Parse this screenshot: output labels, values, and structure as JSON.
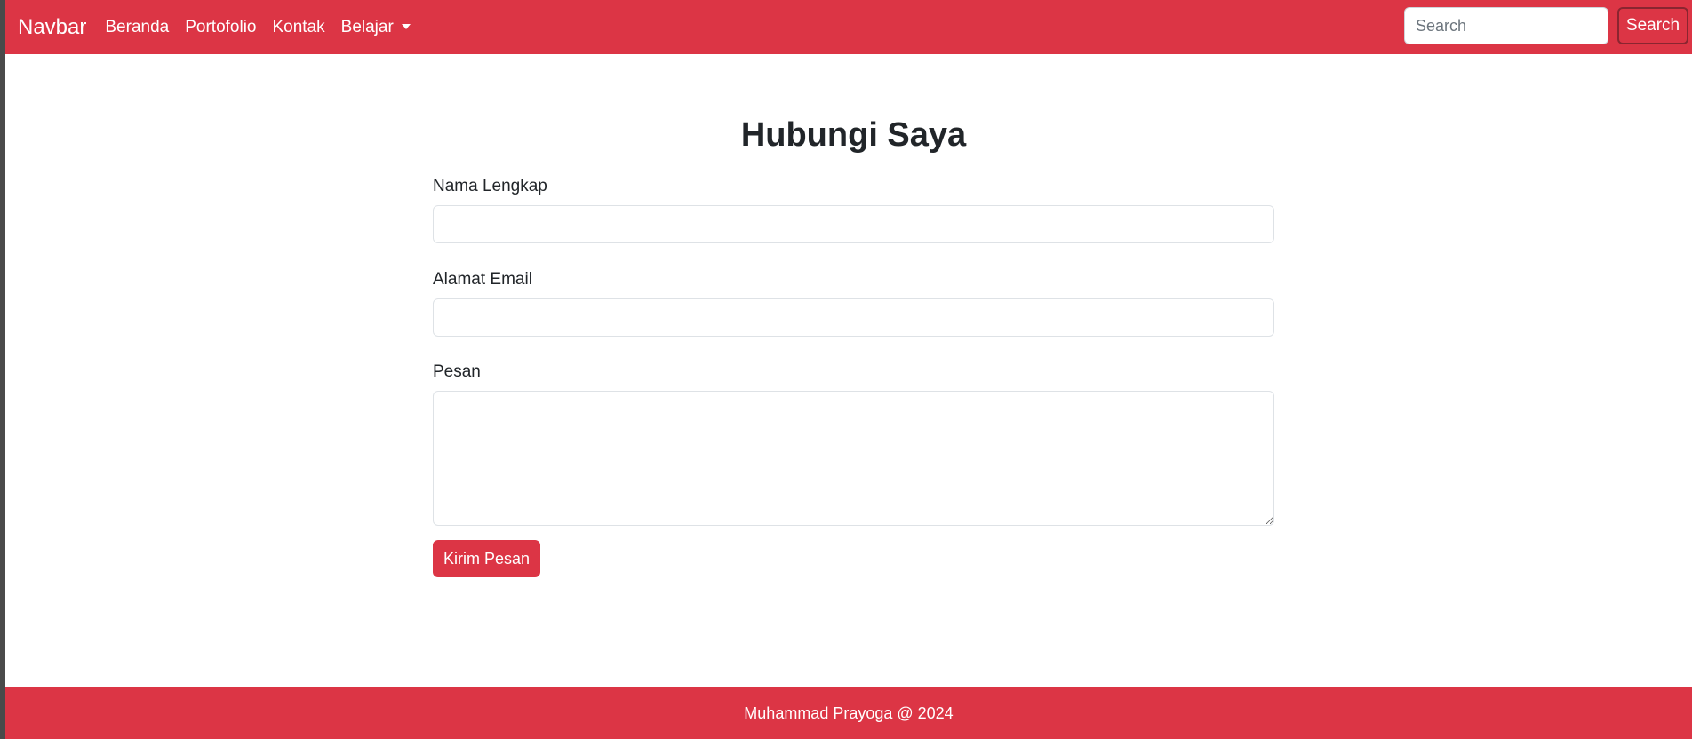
{
  "navbar": {
    "brand": "Navbar",
    "links": [
      {
        "label": "Beranda"
      },
      {
        "label": "Portofolio"
      },
      {
        "label": "Kontak"
      },
      {
        "label": "Belajar"
      }
    ],
    "search": {
      "placeholder": "Search",
      "button_label": "Search"
    }
  },
  "main": {
    "title": "Hubungi Saya",
    "form": {
      "name_label": "Nama Lengkap",
      "name_value": "",
      "email_label": "Alamat Email",
      "email_value": "",
      "message_label": "Pesan",
      "message_value": "",
      "submit_label": "Kirim Pesan"
    }
  },
  "footer": {
    "text": "Muhammad Prayoga @ 2024"
  },
  "colors": {
    "primary": "#dc3545",
    "text": "#212529",
    "background": "#ffffff"
  }
}
